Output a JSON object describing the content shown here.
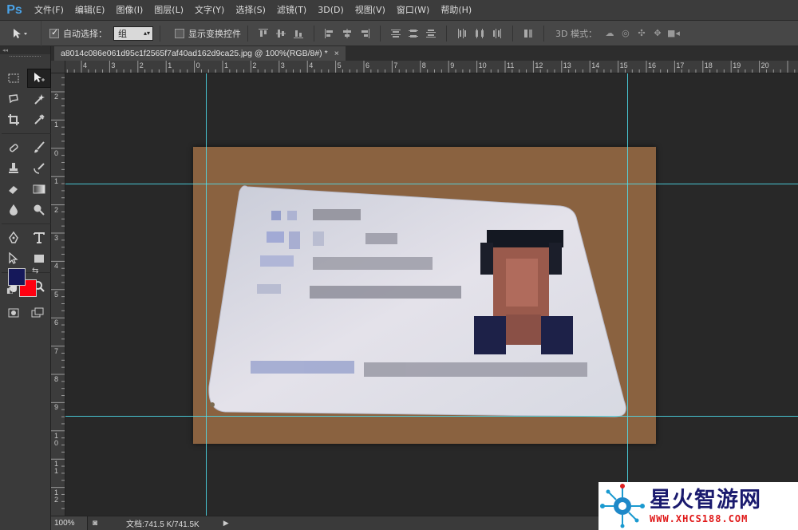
{
  "app": {
    "logo": "Ps"
  },
  "menu": [
    "文件(F)",
    "编辑(E)",
    "图像(I)",
    "图层(L)",
    "文字(Y)",
    "选择(S)",
    "滤镜(T)",
    "3D(D)",
    "视图(V)",
    "窗口(W)",
    "帮助(H)"
  ],
  "options": {
    "auto_select_label": "自动选择：",
    "auto_select_checked": true,
    "auto_select_value": "组",
    "show_transform_label": "显示变换控件",
    "show_transform_checked": false,
    "mode_3d_label": "3D 模式："
  },
  "document": {
    "tab_title": "a8014c086e061d95c1f2565f7af40ad162d9ca25.jpg @ 100%(RGB/8#) *",
    "close_glyph": "×"
  },
  "ruler": {
    "horizontal": [
      "4",
      "3",
      "2",
      "1",
      "0",
      "1",
      "2",
      "3",
      "4",
      "5",
      "6",
      "7",
      "8",
      "9",
      "10",
      "11",
      "12",
      "13",
      "14",
      "15",
      "16",
      "17",
      "18",
      "19",
      "20"
    ],
    "vertical": [
      "2",
      "1",
      "0",
      "1",
      "2",
      "3",
      "4",
      "5",
      "6",
      "7",
      "8",
      "9",
      "1\n0",
      "1\n1",
      "1\n2",
      "1\n3"
    ]
  },
  "colors": {
    "foreground": "#15185a",
    "background": "#ff0011",
    "guide": "#4ee0f0",
    "canvas_bg": "#8a6240"
  },
  "status": {
    "zoom": "100%",
    "doc_info": "文档:741.5 K/741.5K"
  },
  "watermark": {
    "name": "星火智游网",
    "url": "WWW.XHCS188.COM"
  }
}
